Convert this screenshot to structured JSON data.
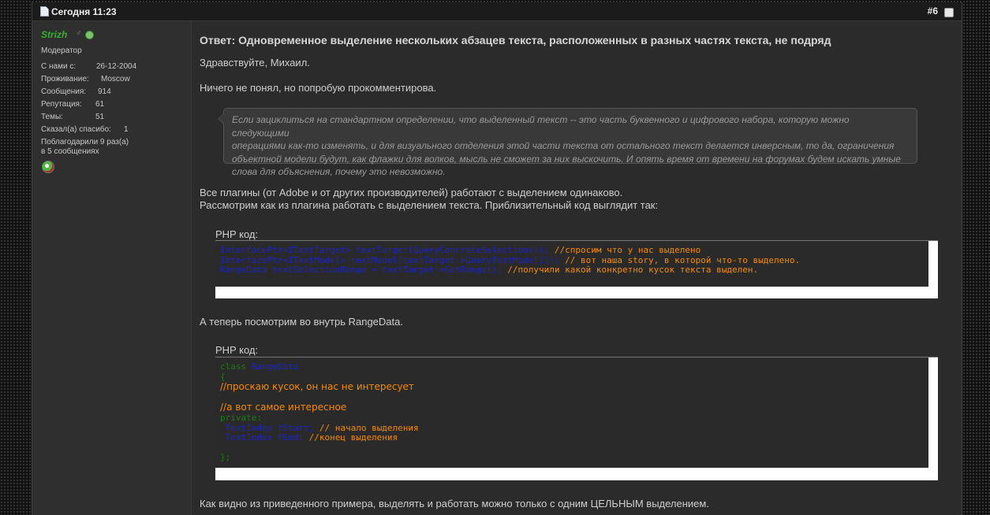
{
  "post": {
    "date": "Сегодня 11:23",
    "number": "#6"
  },
  "user": {
    "name": "Strizh",
    "gender_symbol": "♂",
    "rank": "Модератор",
    "joined_label": "С нами с:",
    "joined_value": "26-12-2004",
    "location_label": "Проживание:",
    "location_value": "Moscow",
    "posts_label": "Сообщения:",
    "posts_value": "914",
    "rep_label": "Репутация:",
    "rep_value": "61",
    "threads_label": "Темы:",
    "threads_value": "51",
    "thanks_label": "Сказал(а) спасибо:",
    "thanks_value": "1",
    "thanked_line1": "Поблагодарили 9 раз(а)",
    "thanked_line2": "в 5 сообщениях"
  },
  "content": {
    "title": "Ответ: Одновременное выделение нескольких абзацев текста, расположенных в разных частях текста, не подряд",
    "greeting": "Здравствуйте, Михаил.",
    "p1": "Ничего не понял, но попробую прокомментирова.",
    "quote": {
      "line1": "Если зациклиться на стандартном определении, что выделенный текст -- это часть буквенного и цифрового набора, которую можно следующими",
      "line2": "операциями как-то изменять, и для визуального отделения этой части текста от остального текст делается инверсным, то да, ограничения",
      "line3": "объектной модели будут, как флажки для волков, мысль не сможет за них выскочить. И опять время от времени на форумах будем искать умные",
      "line4": "слова для объяснения, почему это невозможно."
    },
    "p2_line1": "Все плагины (от Adobe и от других производителей) работают с выделением одинаково.",
    "p2_line2": "Рассмотрим как из плагина работать с выделением текста. Приблизительный код выглядит так:",
    "code1_label": "PHP код:",
    "code1": {
      "l1_code": "InterfacePtr<ITextTarget> textTarget(QueryConcreteSelection());",
      "l1_comment": " //спросим что у нас выделено",
      "l2_code": "InterfacePtr<ITextModel> textModel(textTarget->QueryTextModel());",
      "l2_comment": " // вот наша story, в которой что-то выделено.",
      "l3_code": "RangeData textSelectionRange = textTarget->GetRange();",
      "l3_comment": " //получили какой конкретно кусок текста выделен."
    },
    "p3": "А теперь посмотрим во внутрь RangeData.",
    "code2_label": "PHP код:",
    "code2": {
      "l1_kw": "class ",
      "l1_name": "RangeData",
      "l2": "{",
      "l3": "//проскаю кусок, он нас не интересует",
      "l5": "//а вот самое интересное",
      "l6": "private:",
      "l7_code": " TextIndex fStart;",
      "l7_comment": " // начало выделения",
      "l8_code": " TextIndex fEnd;",
      "l8_comment": " //конец выделения",
      "l10": "};"
    },
    "p4": "Как видно из приведенного примера, выделять и работать можно только с одним ЦЕЛЬНЫМ выделением."
  }
}
